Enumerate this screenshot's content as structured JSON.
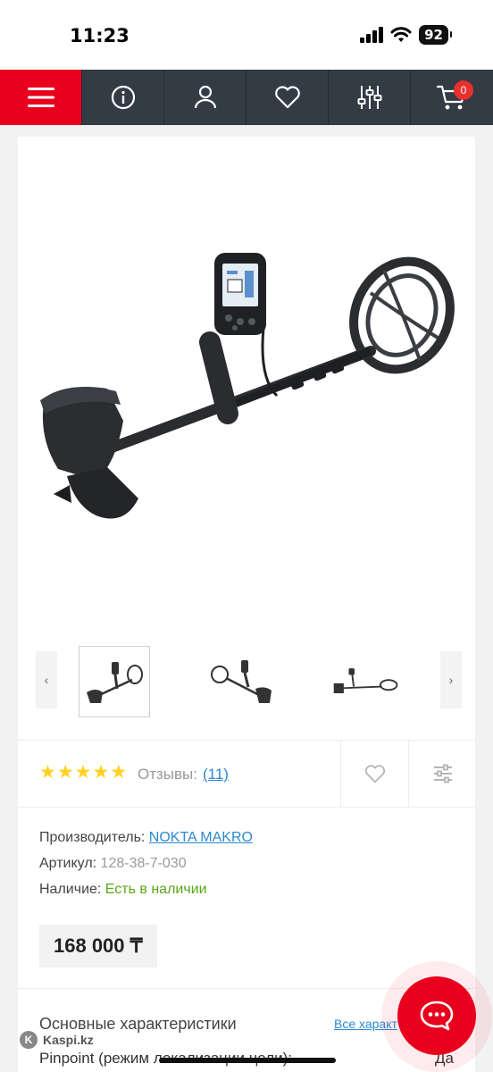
{
  "status_bar": {
    "time": "11:23",
    "battery": "92"
  },
  "nav": {
    "cart_count": "0"
  },
  "colors": {
    "brand_red": "#e8001c",
    "nav_bg": "#333b45",
    "link_blue": "#2b8ad3",
    "in_stock_green": "#5aa619",
    "star_yellow": "#ffd21f"
  },
  "icons": [
    "menu-icon",
    "info-icon",
    "user-icon",
    "heart-icon",
    "filter-icon",
    "cart-icon",
    "chevron-left-icon",
    "chevron-right-icon",
    "compare-icon",
    "chat-icon"
  ],
  "thumbnails": {
    "arrow_left": "‹",
    "arrow_right": "›"
  },
  "rating": {
    "stars": 5,
    "reviews_label": "Отзывы:",
    "reviews_count": "(11)"
  },
  "info": {
    "manufacturer_label": "Производитель:",
    "manufacturer_value": "NOKTA MAKRO",
    "sku_label": "Артикул:",
    "sku_value": "128-38-7-030",
    "availability_label": "Наличие:",
    "availability_value": "Есть в наличии"
  },
  "price": "168 000 ₸",
  "specs": {
    "title": "Основные характеристики",
    "all_link": "Все характ",
    "row1_label": "Pinpoint (режим локализации цели):",
    "row1_value": "Да"
  },
  "watermark": "Kaspi.kz"
}
